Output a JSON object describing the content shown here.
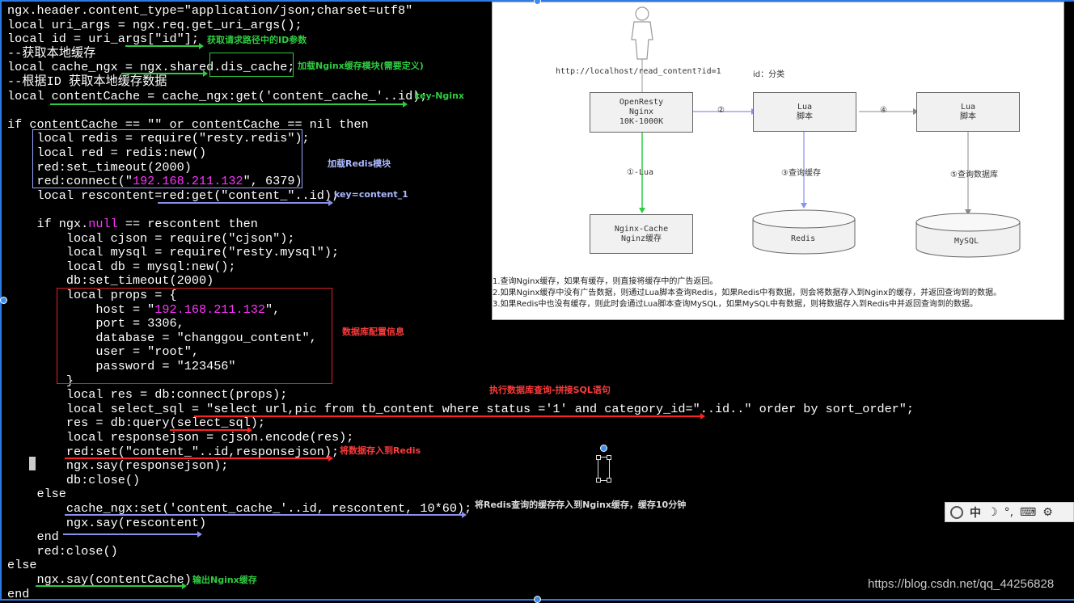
{
  "code_lines": [
    {
      "text": "ngx.header.content_type=\"application/json;charset=utf8\""
    },
    {
      "text": "local uri_args = ngx.req.get_uri_args();"
    },
    {
      "text": "local id = uri_args[\"id\"];"
    },
    {
      "text": "--获取本地缓存"
    },
    {
      "text": "local cache_ngx = ngx.shared.dis_cache;"
    },
    {
      "text": "--根据ID 获取本地缓存数据"
    },
    {
      "text": "local contentCache = cache_ngx:get('content_cache_'..id);"
    },
    {
      "text": ""
    },
    {
      "text": "if contentCache == \"\" or contentCache == nil then"
    },
    {
      "text": "    local redis = require(\"resty.redis\");"
    },
    {
      "text": "    local red = redis:new()"
    },
    {
      "text": "    red:set_timeout(2000)"
    },
    {
      "text": "    red:connect(\"",
      "hl": "192.168.211.132",
      "after": "\", 6379)"
    },
    {
      "text": "    local rescontent=red:get(\"content_\"..id);"
    },
    {
      "text": ""
    },
    {
      "text": "    if ngx.",
      "hl": "null",
      "after": " == rescontent then"
    },
    {
      "text": "        local cjson = require(\"cjson\");"
    },
    {
      "text": "        local mysql = require(\"resty.mysql\");"
    },
    {
      "text": "        local db = mysql:new();"
    },
    {
      "text": "        db:set_timeout(2000)"
    },
    {
      "text": "        local props = {"
    },
    {
      "text": "            host = \"",
      "hl": "192.168.211.132",
      "after": "\","
    },
    {
      "text": "            port = 3306,"
    },
    {
      "text": "            database = \"changgou_content\","
    },
    {
      "text": "            user = \"root\","
    },
    {
      "text": "            password = \"123456\""
    },
    {
      "text": "        }"
    },
    {
      "text": "        local res = db:connect(props);"
    },
    {
      "text": "        local select_sql = \"select url,pic from tb_content where status ='1' and category_id=\"..id..\" order by sort_order\";"
    },
    {
      "text": "        res = db:query(select_sql);"
    },
    {
      "text": "        local responsejson = cjson.encode(res);"
    },
    {
      "text": "        red:set(\"content_\"..id,responsejson);"
    },
    {
      "text": "        ngx.say(responsejson);"
    },
    {
      "text": "        db:close()"
    },
    {
      "text": "    else"
    },
    {
      "text": "        cache_ngx:set('content_cache_'..id, rescontent, 10*60);"
    },
    {
      "text": "        ngx.say(rescontent)"
    },
    {
      "text": "    end"
    },
    {
      "text": "    red:close()"
    },
    {
      "text": "else"
    },
    {
      "text": "    ngx.say(contentCache)"
    },
    {
      "text": "end"
    }
  ],
  "annotations": {
    "get_id": "获取请求路径中的ID参数",
    "load_nginx_cache": "加载Nginx缓存模块(需要定义)",
    "key_nginx": "key-Nginx",
    "load_redis": "加载Redis模块",
    "key_content": "key=content_1",
    "db_config": "数据库配置信息",
    "exec_query": "执行数据库查询-拼接SQL语句",
    "store_redis": "将数据存入到Redis",
    "store_nginx": "将Redis查询的缓存存入到Nginx缓存，缓存10分钟",
    "output_nginx": "输出Nginx缓存"
  },
  "diagram": {
    "url": "http://localhost/read_content?id=1",
    "id_note": "id：分类",
    "openresty": [
      "OpenResty",
      "Nginx",
      "10K-1000K"
    ],
    "lua_script_a": [
      "Lua",
      "脚本"
    ],
    "lua_script_b": [
      "Lua",
      "脚本"
    ],
    "nginx_cache": [
      "Nginx-Cache",
      "Nginz缓存"
    ],
    "redis": "Redis",
    "mysql": "MySQL",
    "step2": "②",
    "step4": "④",
    "step1": "①-Lua",
    "step3": "③查询缓存",
    "step5": "⑤查询数据库",
    "legend": [
      "1.查询Nginx缓存，如果有缓存，则直接将缓存中的广告返回。",
      "2.如果Nginx缓存中没有广告数据，则通过Lua脚本查询Redis，如果Redis中有数据，则会将数据存入到Nginx的缓存，并返回查询到的数据。",
      "3.如果Redis中也没有缓存，则此时会通过Lua脚本查询MySQL，如果MySQL中有数据，则将数据存入到Redis中并返回查询到的数据。"
    ]
  },
  "ime": {
    "lang": "中",
    "moon": "☽",
    "punct": "°,",
    "keyboard": "⌨",
    "settings": "⚙"
  },
  "watermark": "https://blog.csdn.net/qq_44256828",
  "colors": {
    "highlight": "#ff33ff",
    "green_note": "#2ecc40",
    "blue_note": "#aab8ff",
    "red_note": "#ff3b3b"
  }
}
